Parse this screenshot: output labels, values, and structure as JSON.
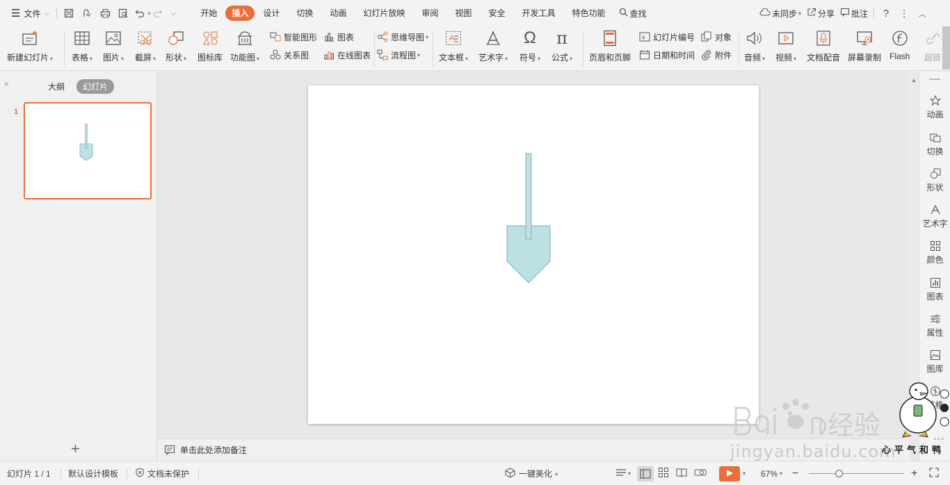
{
  "menubar": {
    "file_label": "文件",
    "tabs": [
      "开始",
      "插入",
      "设计",
      "切换",
      "动画",
      "幻灯片放映",
      "审阅",
      "视图",
      "安全",
      "开发工具",
      "特色功能"
    ],
    "active_tab": "插入",
    "search_label": "查找",
    "sync_label": "未同步",
    "share_label": "分享",
    "comment_label": "批注"
  },
  "ribbon": {
    "new_slide": "新建幻灯片",
    "table": "表格",
    "image": "图片",
    "screenshot": "截屏",
    "shape": "形状",
    "icon_lib": "图标库",
    "function_chart": "功能图",
    "smart_art": "智能图形",
    "chart": "图表",
    "relation": "关系图",
    "online_chart": "在线图表",
    "mind_map": "思维导图",
    "flow_chart": "流程图",
    "textbox": "文本框",
    "wordart": "艺术字",
    "symbol": "符号",
    "formula": "公式",
    "header_footer": "页眉和页脚",
    "slide_number": "幻灯片编号",
    "object": "对象",
    "date_time": "日期和时间",
    "attachment": "附件",
    "audio": "音频",
    "video": "视频",
    "doc_dub": "文档配音",
    "screen_record": "屏幕录制",
    "flash": "Flash",
    "hyperlink": "超链"
  },
  "leftpane": {
    "outline_tab": "大纲",
    "slides_tab": "幻灯片",
    "slide_number": "1"
  },
  "notes": {
    "placeholder": "单击此处添加备注"
  },
  "rightpanel": {
    "items": [
      "动画",
      "切换",
      "形状",
      "艺术字",
      "颜色",
      "图表",
      "属性",
      "图库",
      "风格"
    ]
  },
  "statusbar": {
    "slide_info": "幻灯片 1 / 1",
    "template": "默认设计模板",
    "protect": "文档未保护",
    "beautify": "一键美化",
    "zoom": "67%"
  },
  "watermark": {
    "url": "jingyan.baidu.com",
    "side_text": "心平气和鸭"
  },
  "colors": {
    "accent": "#e96e3b",
    "shape_fill": "#bde0e3",
    "shape_stroke": "#7fb4ba"
  }
}
